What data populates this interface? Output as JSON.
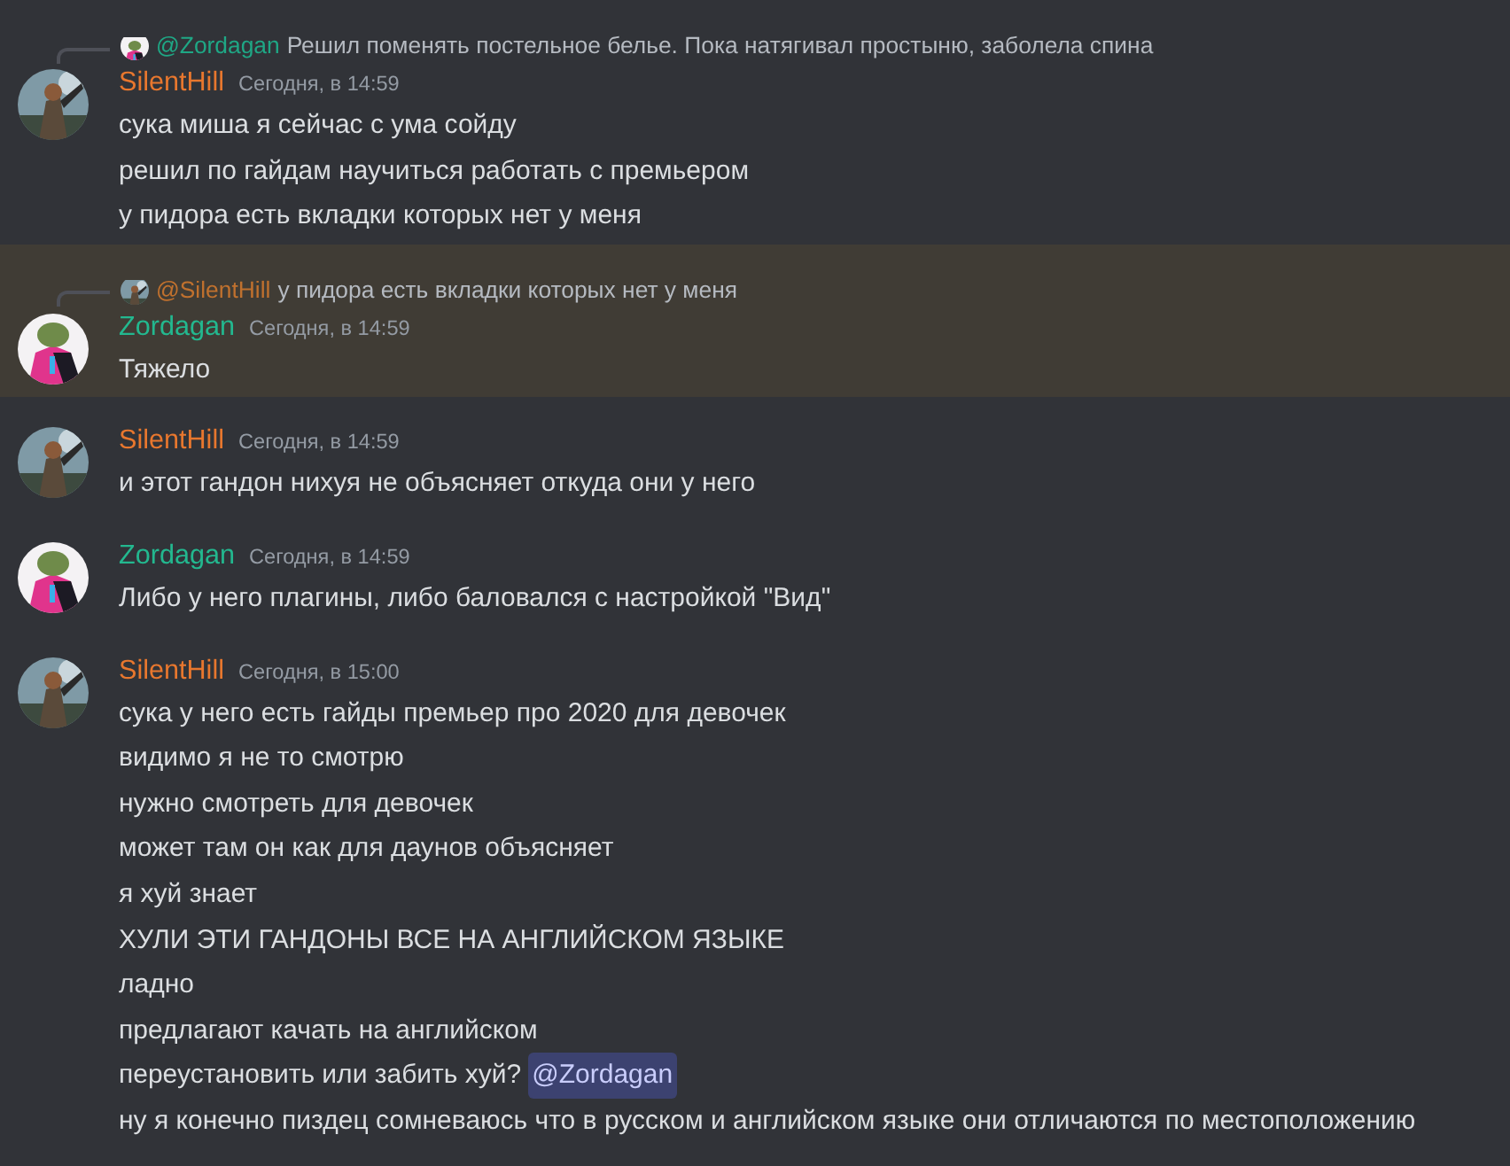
{
  "messages": [
    {
      "author": "SilentHill",
      "color": "#e8772e",
      "time": "Сегодня, в 14:59",
      "highlighted": false,
      "reply": {
        "author": "@Zordagan",
        "color": "#1fa785",
        "text": "Решил поменять постельное белье. Пока натягивал простыню, заболела спина"
      },
      "lines": [
        {
          "text": "сука миша я сейчас с ума сойду"
        },
        {
          "text": "решил по гайдам научиться работать с премьером"
        },
        {
          "text": "у пидора есть вкладки которых нет у меня"
        }
      ]
    },
    {
      "author": "Zordagan",
      "color": "#23b88f",
      "time": "Сегодня, в 14:59",
      "highlighted": true,
      "reply": {
        "author": "@SilentHill",
        "color": "#c0712e",
        "text": "у пидора есть вкладки которых нет у меня"
      },
      "lines": [
        {
          "text": "Тяжело"
        }
      ]
    },
    {
      "author": "SilentHill",
      "color": "#e8772e",
      "time": "Сегодня, в 14:59",
      "highlighted": false,
      "lines": [
        {
          "text": "и этот гандон нихуя не объясняет откуда они у него"
        }
      ]
    },
    {
      "author": "Zordagan",
      "color": "#23b88f",
      "time": "Сегодня, в 14:59",
      "highlighted": false,
      "lines": [
        {
          "text": "Либо у него плагины, либо баловался с настройкой \"Вид\""
        }
      ]
    },
    {
      "author": "SilentHill",
      "color": "#e8772e",
      "time": "Сегодня, в 15:00",
      "highlighted": false,
      "lines": [
        {
          "text": "сука у него есть гайды премьер про 2020 для девочек"
        },
        {
          "text": "видимо я не то смотрю"
        },
        {
          "text": "нужно смотреть для девочек"
        },
        {
          "text": "может там он как для даунов объясняет"
        },
        {
          "text": "я хуй знает"
        },
        {
          "text": "ХУЛИ ЭТИ ГАНДОНЫ ВСЕ НА АНГЛИЙСКОМ ЯЗЫКЕ"
        },
        {
          "text": "ладно"
        },
        {
          "text": "предлагают качать на английском"
        },
        {
          "text": "переустановить или забить хуй?",
          "mention": "@Zordagan"
        },
        {
          "text": "ну я конечно пиздец сомневаюсь что в русском и английском языке они отличаются по местоположению"
        }
      ]
    }
  ]
}
